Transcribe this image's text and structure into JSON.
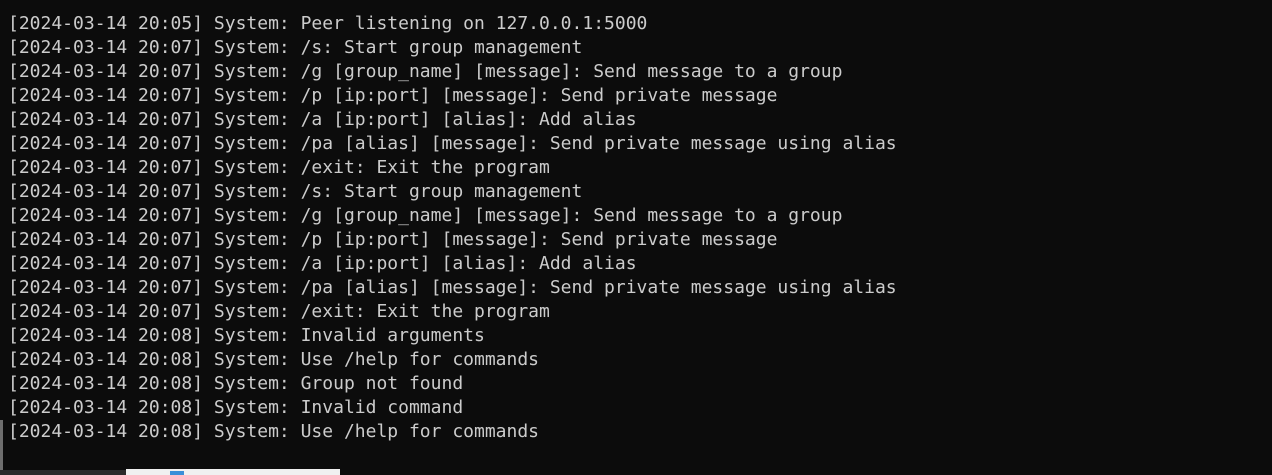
{
  "terminal": {
    "lines": [
      "[2024-03-14 20:05] System: Peer listening on 127.0.0.1:5000",
      "[2024-03-14 20:07] System: /s: Start group management",
      "[2024-03-14 20:07] System: /g [group_name] [message]: Send message to a group",
      "[2024-03-14 20:07] System: /p [ip:port] [message]: Send private message",
      "[2024-03-14 20:07] System: /a [ip:port] [alias]: Add alias",
      "[2024-03-14 20:07] System: /pa [alias] [message]: Send private message using alias",
      "[2024-03-14 20:07] System: /exit: Exit the program",
      "[2024-03-14 20:07] System: /s: Start group management",
      "[2024-03-14 20:07] System: /g [group_name] [message]: Send message to a group",
      "[2024-03-14 20:07] System: /p [ip:port] [message]: Send private message",
      "[2024-03-14 20:07] System: /a [ip:port] [alias]: Add alias",
      "[2024-03-14 20:07] System: /pa [alias] [message]: Send private message using alias",
      "[2024-03-14 20:07] System: /exit: Exit the program",
      "[2024-03-14 20:08] System: Invalid arguments",
      "[2024-03-14 20:08] System: Use /help for commands",
      "[2024-03-14 20:08] System: Group not found",
      "[2024-03-14 20:08] System: Invalid command",
      "[2024-03-14 20:08] System: Use /help for commands"
    ],
    "prompt": ">"
  },
  "colors": {
    "background": "#0c0c0c",
    "foreground": "#cccccc"
  }
}
